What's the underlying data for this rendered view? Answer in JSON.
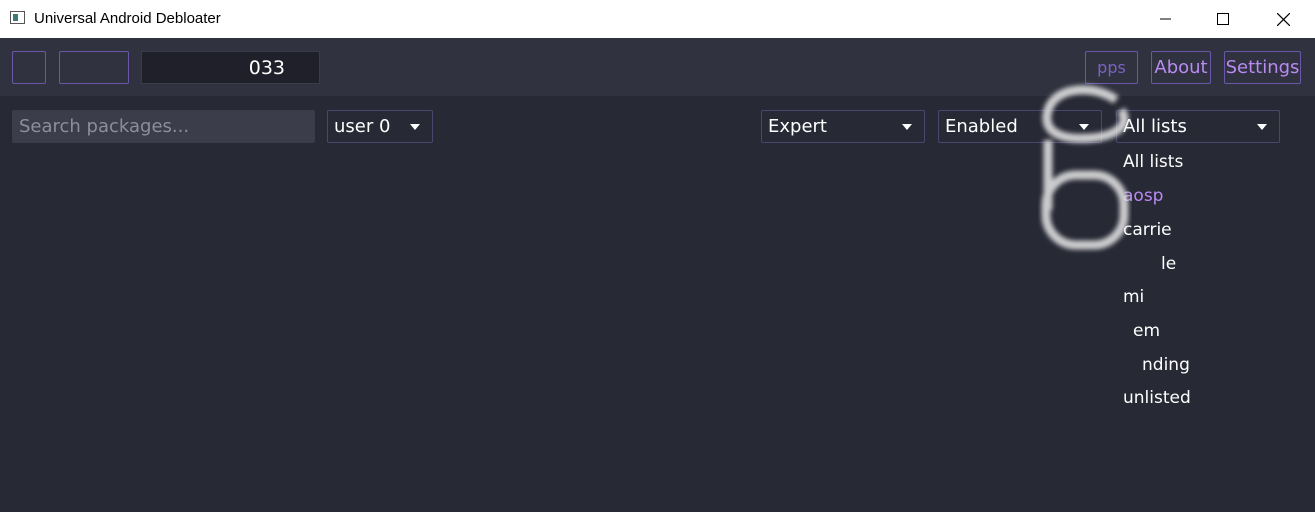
{
  "window": {
    "title": "Universal Android Debloater",
    "minimize_icon": "minimize-icon",
    "maximize_icon": "maximize-icon",
    "close_icon": "close-icon"
  },
  "toolbar": {
    "device_value": "033",
    "apps_label": "pps",
    "about_label": "About",
    "settings_label": "Settings"
  },
  "filters": {
    "search_placeholder": "Search packages...",
    "user_value": "user 0",
    "removal_value": "Expert",
    "state_value": "Enabled",
    "list_value": "All lists"
  },
  "list_dropdown": {
    "items": [
      "All lists",
      "aosp",
      "carrie",
      "le",
      "mi",
      "em",
      "nding",
      "unlisted"
    ],
    "selected_index": 1
  },
  "colors": {
    "accent": "#b98af2",
    "background": "#272935",
    "toolbar": "#30323f"
  }
}
